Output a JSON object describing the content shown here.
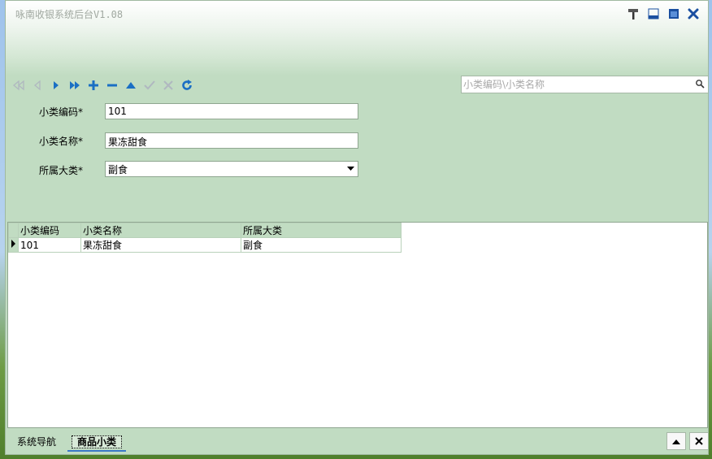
{
  "window": {
    "title": "咏南收银系统后台V1.08"
  },
  "toolbar": {
    "buttons": [
      {
        "name": "first-record",
        "icon": "first-icon"
      },
      {
        "name": "prev-record",
        "icon": "prev-icon"
      },
      {
        "name": "next-record",
        "icon": "next-icon"
      },
      {
        "name": "last-record",
        "icon": "last-icon"
      },
      {
        "name": "add-record",
        "icon": "plus-icon"
      },
      {
        "name": "delete-record",
        "icon": "minus-icon"
      },
      {
        "name": "edit-record",
        "icon": "triangle-up-icon"
      },
      {
        "name": "post-record",
        "icon": "check-icon"
      },
      {
        "name": "cancel-record",
        "icon": "x-icon"
      },
      {
        "name": "refresh",
        "icon": "refresh-icon"
      }
    ]
  },
  "search": {
    "placeholder": "小类编码\\小类名称"
  },
  "form": {
    "code_label": "小类编码*",
    "code_value": "101",
    "name_label": "小类名称*",
    "name_value": "果冻甜食",
    "category_label": "所属大类*",
    "category_value": "副食"
  },
  "grid": {
    "columns": [
      "小类编码",
      "小类名称",
      "所属大类"
    ],
    "rows": [
      [
        "101",
        "果冻甜食",
        "副食"
      ]
    ]
  },
  "statusbar": {
    "tabs": [
      "系统导航",
      "商品小类"
    ],
    "active_tab": "商品小类"
  },
  "colors": {
    "panel": "#c1dcc2",
    "toolbar_icon": "#1a6fc4",
    "toolbar_icon_disabled": "#b0b8c0"
  }
}
